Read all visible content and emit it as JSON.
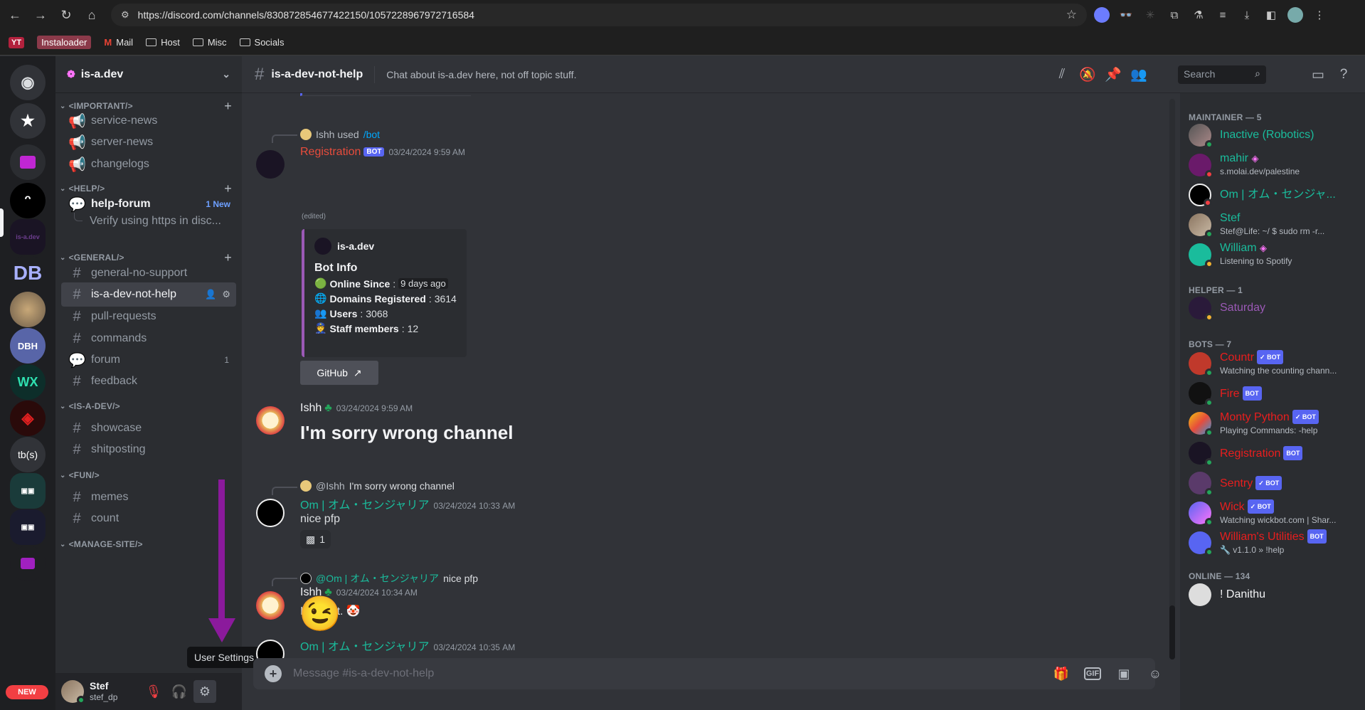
{
  "browser": {
    "url": "https://discord.com/channels/830872854677422150/1057228967972716584",
    "bookmarks": [
      "YT",
      "Instaloader",
      "Mail",
      "Host",
      "Misc",
      "Socials"
    ]
  },
  "server": {
    "name": "is-a.dev"
  },
  "categories": {
    "important": "<IMPORTANT/>",
    "help": "<HELP/>",
    "general": "<GENERAL/>",
    "isadev": "<IS-A-DEV/>",
    "fun": "<FUN/>",
    "manage": "<MANAGE-SITE/>"
  },
  "channels": {
    "service_news": "service-news",
    "server_news": "server-news",
    "changelogs": "changelogs",
    "help_forum": "help-forum",
    "help_forum_badge": "1 New",
    "thread": "Verify using https in disc...",
    "general_no_support": "general-no-support",
    "is_a_dev_not_help": "is-a-dev-not-help",
    "pull_requests": "pull-requests",
    "commands": "commands",
    "forum": "forum",
    "forum_badge": "1",
    "feedback": "feedback",
    "showcase": "showcase",
    "shitposting": "shitposting",
    "memes": "memes",
    "count": "count"
  },
  "guilds": {
    "tbs": "tb(s)",
    "dbh": "DBH",
    "new_badge": "NEW"
  },
  "user_panel": {
    "display_name": "Stef",
    "username": "stef_dp",
    "tooltip": "User Settings"
  },
  "chat": {
    "channel_name": "is-a-dev-not-help",
    "topic": "Chat about is-a.dev here, not off topic stuff.",
    "search_placeholder": "Search",
    "composer_placeholder": "Message #is-a-dev-not-help"
  },
  "messages": {
    "m1": {
      "interaction_user": "Ishh used",
      "interaction_cmd": "/bot",
      "author": "Registration",
      "bot_tag": "BOT",
      "timestamp": "03/24/2024 9:59 AM",
      "edited": "(edited)",
      "embed_author": "is-a.dev",
      "embed_title": "Bot Info",
      "online_since_label": "Online Since",
      "online_since_value": "9 days ago",
      "domains_label": "Domains Registered",
      "domains_value": "3614",
      "users_label": "Users",
      "users_value": "3068",
      "staff_label": "Staff members",
      "staff_value": "12",
      "button": "GitHub"
    },
    "m2": {
      "author": "Ishh",
      "timestamp": "03/24/2024 9:59 AM",
      "text": "I'm sorry wrong channel"
    },
    "m3": {
      "reply_user": "@Ishh",
      "reply_text": "I'm sorry wrong channel",
      "author": "Om | オム・センジャリア",
      "timestamp": "03/24/2024 10:33 AM",
      "text": "nice pfp",
      "reaction_count": "1"
    },
    "m4": {
      "reply_user": "@Om | オム・センジャリア",
      "reply_text": "nice pfp",
      "author": "Ishh",
      "timestamp": "03/24/2024 10:34 AM",
      "text": "I drew it."
    },
    "m5": {
      "author": "Om | オム・センジャリア",
      "timestamp": "03/24/2024 10:35 AM",
      "emoji": "😉"
    }
  },
  "members": {
    "maintainer_header": "MAINTAINER — 5",
    "helper_header": "HELPER — 1",
    "bots_header": "BOTS — 7",
    "online_header": "ONLINE — 134",
    "list": [
      {
        "name": "Inactive (Robotics)",
        "sub": ""
      },
      {
        "name": "mahir",
        "sub": "s.molai.dev/palestine"
      },
      {
        "name": "Om | オム・センジャ...",
        "sub": ""
      },
      {
        "name": "Stef",
        "sub": "Stef@Life: ~/ $ sudo rm -r..."
      },
      {
        "name": "William",
        "sub": "Listening to Spotify"
      },
      {
        "name": "Saturday",
        "sub": ""
      },
      {
        "name": "Countr",
        "sub": "Watching the counting chann..."
      },
      {
        "name": "Fire",
        "sub": ""
      },
      {
        "name": "Monty Python",
        "sub": "Playing Commands: -help"
      },
      {
        "name": "Registration",
        "sub": ""
      },
      {
        "name": "Sentry",
        "sub": ""
      },
      {
        "name": "Wick",
        "sub": "Watching wickbot.com | Shar..."
      },
      {
        "name": "William's Utilities",
        "sub": "v1.1.0 » !help"
      },
      {
        "name": "! Danithu",
        "sub": ""
      }
    ],
    "bot_tag": "BOT",
    "verified_bot_tag": "✓ BOT"
  },
  "colors": {
    "accent": "#5865f2",
    "maintainer": "#1abc9c",
    "helper": "#9b59b6",
    "bot": "#e91e1e",
    "online": "#23a55a"
  }
}
